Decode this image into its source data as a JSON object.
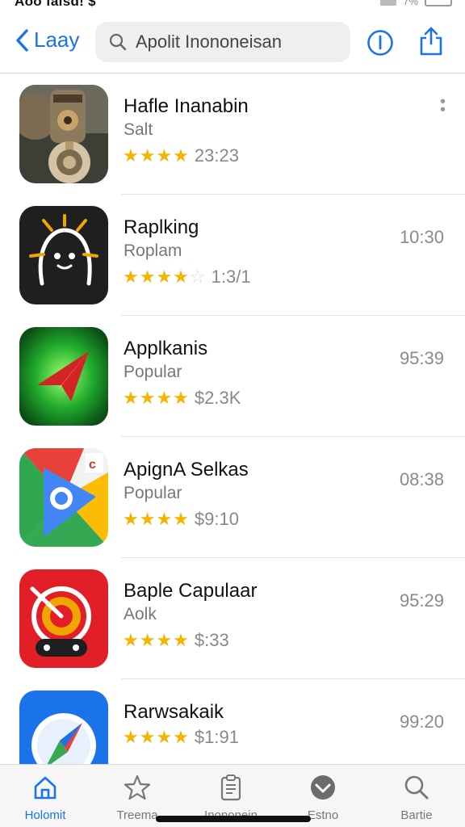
{
  "status_bar": {
    "left_text": "Aoo falsd! $",
    "battery_pct": "7%"
  },
  "nav": {
    "back_label": "Laay",
    "search_text": "Apolit Inononeisan",
    "info_icon": "info-circle-icon",
    "share_icon": "share-icon"
  },
  "apps": [
    {
      "name": "Hafle Inanabin",
      "sub": "Salt",
      "rating_stars": 3.5,
      "price": "23:23",
      "time": "",
      "more": true
    },
    {
      "name": "Raplking",
      "sub": "Roplam",
      "rating_stars": 3.5,
      "price": "1:3/1",
      "time": "10:30",
      "more": false
    },
    {
      "name": "Applkanis",
      "sub": "Popular",
      "rating_stars": 4,
      "price": "$2.3K",
      "time": "95:39",
      "more": false
    },
    {
      "name": "ApignA Selkas",
      "sub": "Popular",
      "rating_stars": 3.5,
      "price": "$9:10",
      "time": "08:38",
      "more": false
    },
    {
      "name": "Baple Capulaar",
      "sub": "Aolk",
      "rating_stars": 3.5,
      "price": "$:33",
      "time": "95:29",
      "more": false
    },
    {
      "name": "Rarwsakaik",
      "sub": "",
      "rating_stars": 3.5,
      "price": "$1:91",
      "time": "99:20",
      "more": false
    }
  ],
  "tabs": [
    {
      "label": "Holomit",
      "icon": "home-icon",
      "active": true
    },
    {
      "label": "Treema",
      "icon": "star-icon",
      "active": false
    },
    {
      "label": "Inononein",
      "icon": "clipboard-icon",
      "active": false
    },
    {
      "label": "Estno",
      "icon": "chevron-badge-icon",
      "active": false
    },
    {
      "label": "Bartie",
      "icon": "search-icon",
      "active": false
    }
  ],
  "colors": {
    "accent": "#1a73e8",
    "star": "#f4b400"
  }
}
